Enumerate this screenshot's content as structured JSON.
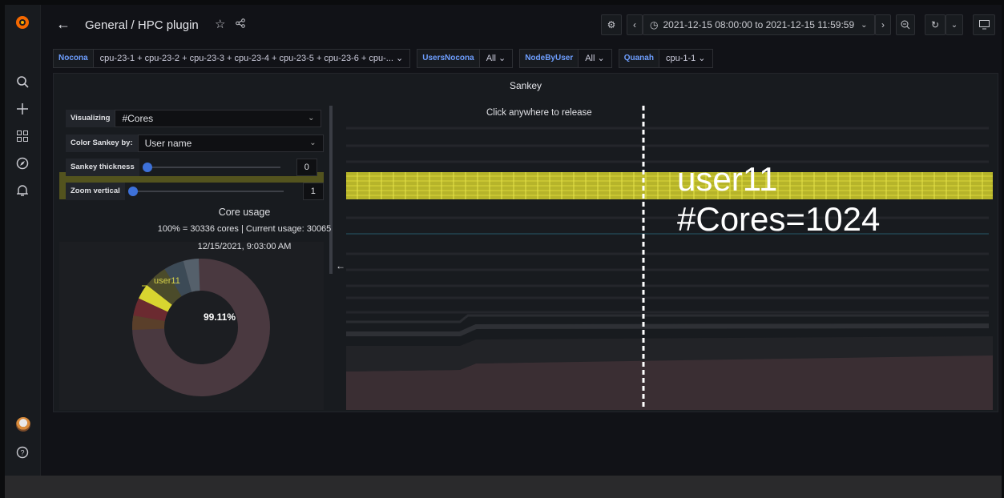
{
  "header": {
    "breadcrumb": "General / HPC plugin",
    "time_range": "2021-12-15 08:00:00 to 2021-12-15 11:59:59"
  },
  "variables": [
    {
      "label": "Nocona",
      "value": "cpu-23-1 + cpu-23-2 + cpu-23-3 + cpu-23-4 + cpu-23-5 + cpu-23-6 + cpu-... ⌄"
    },
    {
      "label": "UsersNocona",
      "value": "All ⌄"
    },
    {
      "label": "NodeByUser",
      "value": "All ⌄"
    },
    {
      "label": "Quanah",
      "value": "cpu-1-1 ⌄"
    }
  ],
  "panel": {
    "title": "Sankey",
    "hint": "Click anywhere to release",
    "controls": {
      "visualizing_label": "Visualizing",
      "visualizing_value": "#Cores",
      "color_label": "Color Sankey by:",
      "color_value": "User name",
      "thickness_label": "Sankey thickness",
      "thickness_value": "0",
      "zoom_label": "Zoom vertical",
      "zoom_value": "1"
    },
    "pie": {
      "title": "Core usage",
      "subtitle": "100% = 30336 cores | Current usage: 30065",
      "datetime": "12/15/2021, 9:03:00 AM",
      "center_value": "99.11%",
      "highlight_label": "user11"
    },
    "tooltip": {
      "user": "user11",
      "metric": "#Cores=1024"
    }
  },
  "colors": {
    "highlight": "#d8d530",
    "accent": "#3d71d9"
  }
}
